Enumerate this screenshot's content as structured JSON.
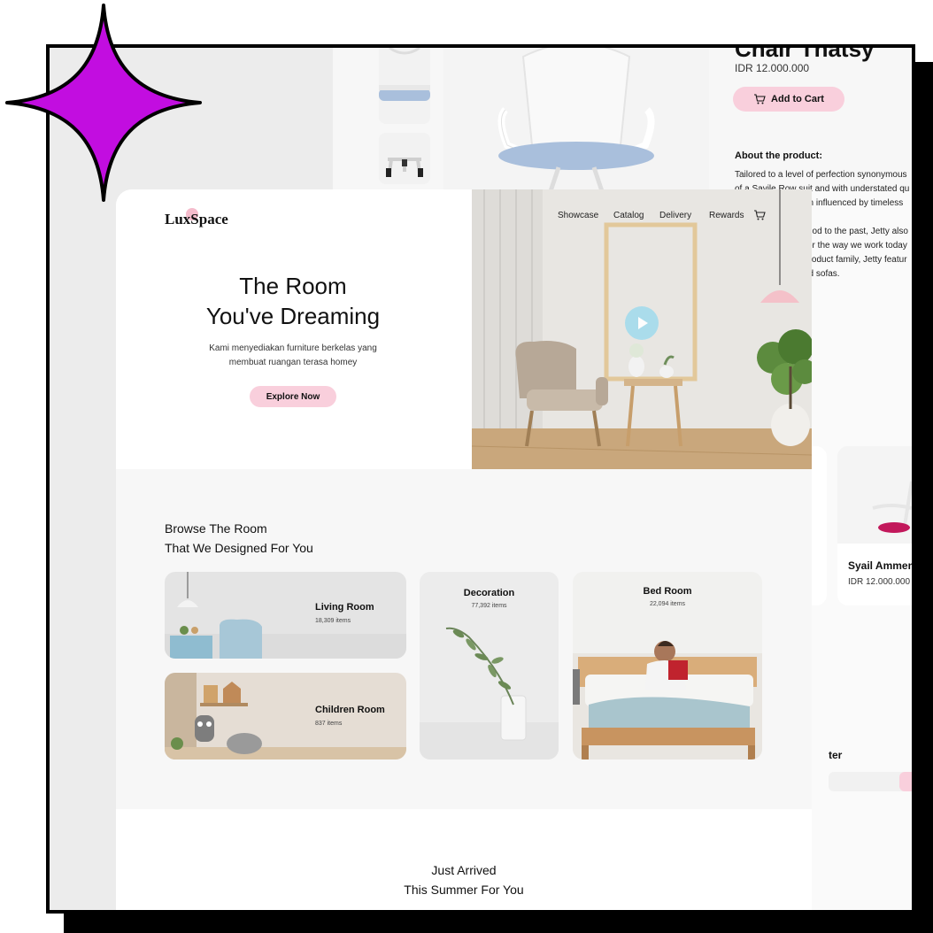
{
  "colors": {
    "accent_pink": "#f9cfdc",
    "play_blue": "#a7dcec",
    "star_purple": "#c20de0"
  },
  "back_page": {
    "product_title": "Chair Thatsy",
    "price": "IDR 12.000.000",
    "add_to_cart_label": "Add to Cart",
    "about_title": "About the product:",
    "about_lines": [
      "Tailored to a level of perfection synonymous",
      "of a Savile Row suit and with understated qu",
      "en influenced by timeless",
      "nod to the past, Jetty also",
      "or the way we work today",
      "product family, Jetty featur",
      "nd sofas."
    ],
    "card": {
      "name": "Syail Ammenc",
      "price": "IDR 12.000.000"
    },
    "newsletter_title": "ter"
  },
  "header": {
    "logo": "LuxSpace",
    "nav": [
      "Showcase",
      "Catalog",
      "Delivery",
      "Rewards"
    ],
    "cart_icon": "cart-icon"
  },
  "hero": {
    "title_line1": "The Room",
    "title_line2": "You've Dreaming",
    "subtitle_line1": "Kami menyediakan furniture berkelas yang",
    "subtitle_line2": "membuat ruangan terasa homey",
    "cta": "Explore Now",
    "play_icon": "play-icon"
  },
  "browse": {
    "title_line1": "Browse The Room",
    "title_line2": "That We Designed For You",
    "categories": [
      {
        "name": "Living Room",
        "count": "18,309 items"
      },
      {
        "name": "Children Room",
        "count": "837 items"
      },
      {
        "name": "Decoration",
        "count": "77,392 items"
      },
      {
        "name": "Bed Room",
        "count": "22,094 items"
      }
    ]
  },
  "arrived": {
    "title_line1": "Just Arrived",
    "title_line2": "This Summer For You"
  }
}
